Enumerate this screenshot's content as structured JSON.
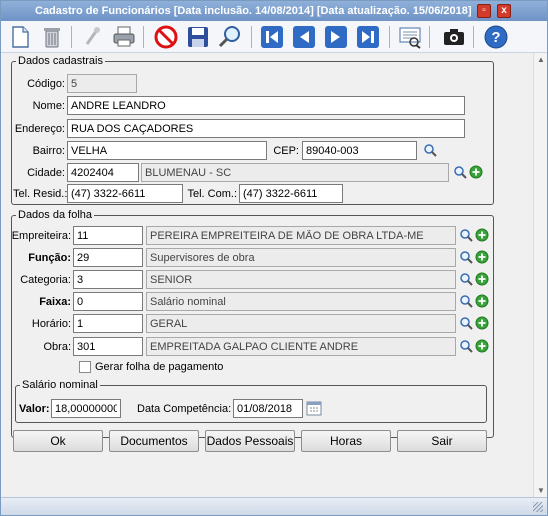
{
  "window": {
    "title": "Cadastro de Funcionários [Data inclusão. 14/08/2014] [Data atualização. 15/06/2018]",
    "minimize_glyph": "▫",
    "close_glyph": "x"
  },
  "toolbar": {
    "icons": [
      "new-document-icon",
      "delete-trash-icon",
      "disabled-tool-icon",
      "print-icon",
      "cancel-icon",
      "save-icon",
      "search-icon",
      "first-record-icon",
      "previous-record-icon",
      "next-record-icon",
      "last-record-icon",
      "report-preview-icon",
      "camera-icon",
      "help-icon"
    ]
  },
  "dados_cadastrais": {
    "legend": "Dados cadastrais",
    "codigo_label": "Código:",
    "codigo": "5",
    "nome_label": "Nome:",
    "nome": "ANDRE LEANDRO",
    "endereco_label": "Endereço:",
    "endereco": "RUA DOS CAÇADORES",
    "bairro_label": "Bairro:",
    "bairro": "VELHA",
    "cep_label": "CEP:",
    "cep": "89040-003",
    "cidade_label": "Cidade:",
    "cidade_codigo": "4202404",
    "cidade_nome": "BLUMENAU - SC",
    "tel_resid_label": "Tel. Resid.:",
    "tel_resid": "(47) 3322-6611",
    "tel_com_label": "Tel. Com.:",
    "tel_com": "(47) 3322-6611"
  },
  "dados_folha": {
    "legend": "Dados da folha",
    "rows": [
      {
        "label": "Empreiteira:",
        "code": "11",
        "desc": "PEREIRA EMPREITEIRA DE MÃO DE OBRA LTDA-ME",
        "bold": false
      },
      {
        "label": "Função:",
        "code": "29",
        "desc": "Supervisores de obra",
        "bold": true
      },
      {
        "label": "Categoria:",
        "code": "3",
        "desc": "SENIOR",
        "bold": false
      },
      {
        "label": "Faixa:",
        "code": "0",
        "desc": "Salário nominal",
        "bold": true
      },
      {
        "label": "Horário:",
        "code": "1",
        "desc": "GERAL",
        "bold": false
      },
      {
        "label": "Obra:",
        "code": "301",
        "desc": "EMPREITADA GALPAO CLIENTE ANDRE",
        "bold": false
      }
    ],
    "gerar_folha_label": "Gerar folha de pagamento",
    "gerar_folha_checked": false
  },
  "salario": {
    "legend": "Salário nominal",
    "valor_label": "Valor:",
    "valor": "18,00000000",
    "competencia_label": "Data Competência:",
    "competencia": "01/08/2018"
  },
  "buttons": {
    "ok": "Ok",
    "documentos": "Documentos",
    "dados_pessoais": "Dados Pessoais",
    "horas": "Horas",
    "sair": "Sair"
  },
  "colors": {
    "title_bar": "#7a9ccc",
    "readonly_field": "#ececec",
    "add_icon": "#3aa23a",
    "close_button": "#d23a2a"
  }
}
